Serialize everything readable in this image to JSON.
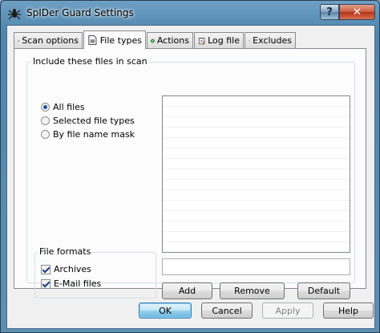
{
  "window": {
    "title": "SpIDer Guard Settings"
  },
  "titlebar_buttons": {
    "help": "?",
    "close": "✕"
  },
  "tabs": [
    {
      "label": "Scan options",
      "icon": "magnifier-icon",
      "active": false
    },
    {
      "label": "File types",
      "icon": "document-icon",
      "active": true
    },
    {
      "label": "Actions",
      "icon": "question-icon",
      "active": false
    },
    {
      "label": "Log file",
      "icon": "notepad-icon",
      "active": false
    },
    {
      "label": "Excludes",
      "icon": "folder-icon",
      "active": false
    }
  ],
  "include_group": {
    "legend": "Include these files in scan",
    "options": [
      {
        "label": "All files",
        "selected": true
      },
      {
        "label": "Selected file types",
        "selected": false
      },
      {
        "label": "By file name mask",
        "selected": false
      }
    ],
    "mask_input": {
      "value": ""
    },
    "buttons": {
      "add": "Add",
      "remove": "Remove",
      "default": "Default"
    }
  },
  "formats_group": {
    "legend": "File formats",
    "items": [
      {
        "label": "Archives",
        "checked": true
      },
      {
        "label": "E-Mail files",
        "checked": true
      }
    ]
  },
  "dialog_buttons": {
    "ok": "OK",
    "cancel": "Cancel",
    "apply": "Apply",
    "help": "Help"
  },
  "colors": {
    "accent": "#3c7fb1",
    "close": "#c85a41",
    "panel": "#fcfcfc"
  }
}
